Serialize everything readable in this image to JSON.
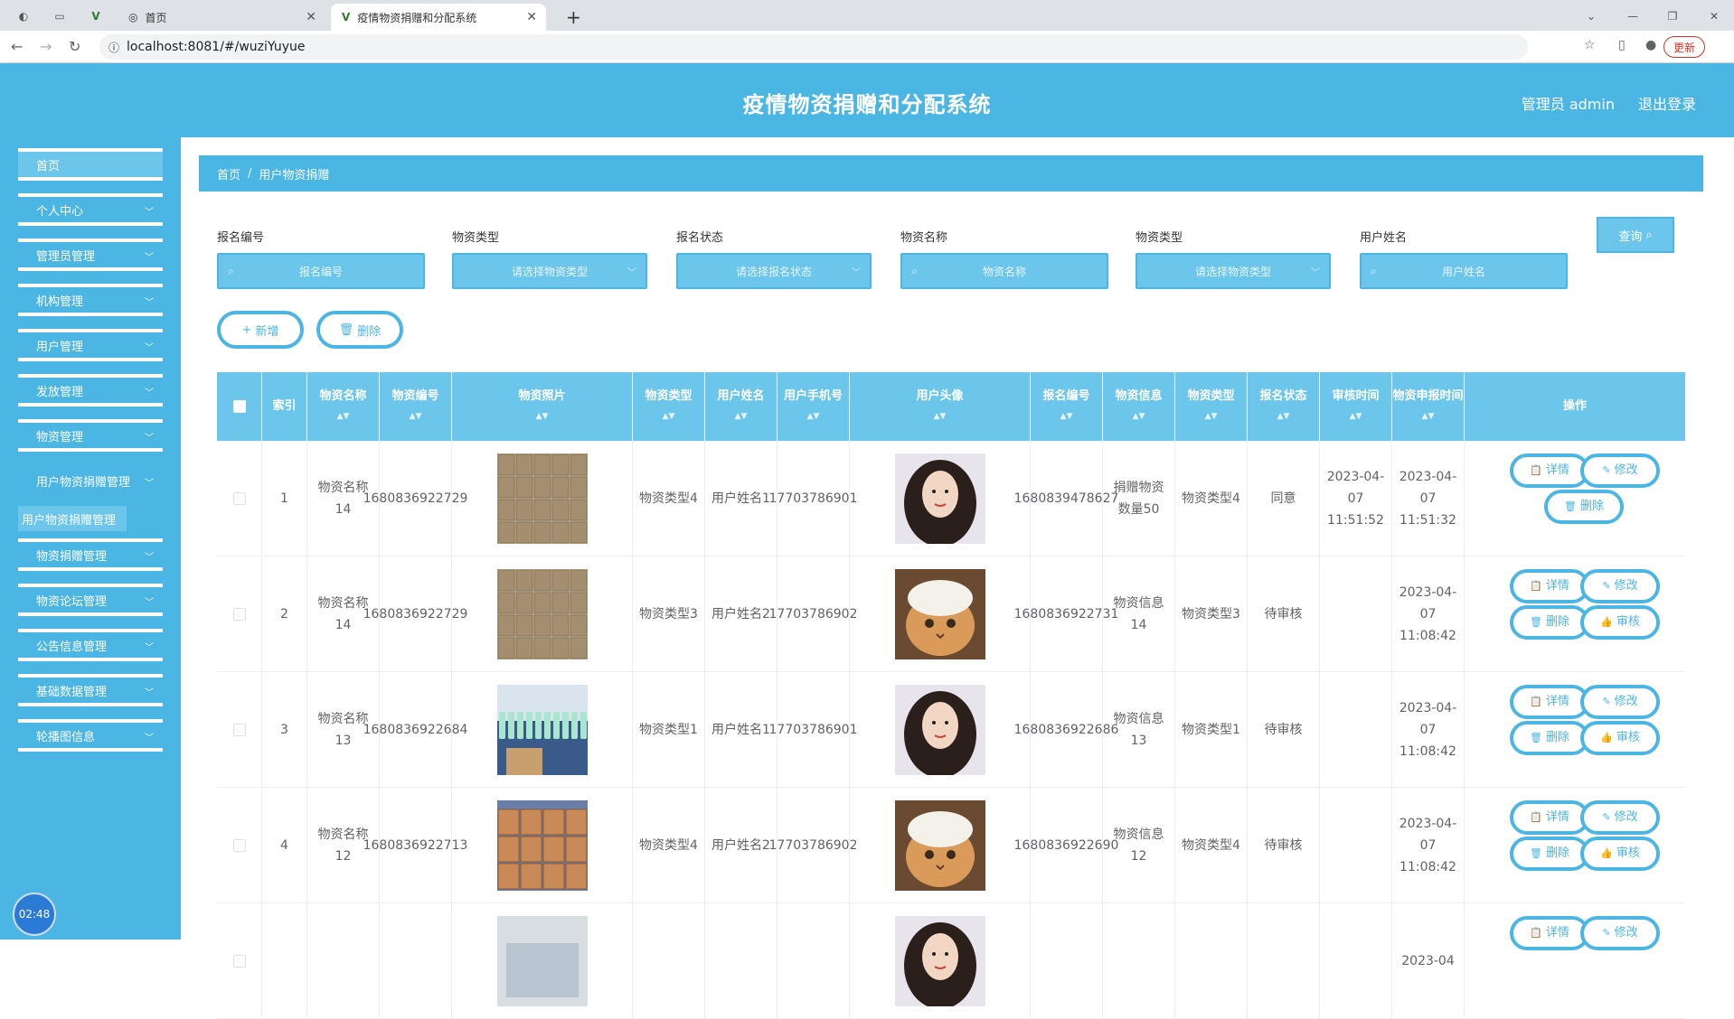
{
  "browser": {
    "tabs": [
      {
        "label": "首页"
      },
      {
        "label": "疫情物资捐赠和分配系统"
      }
    ],
    "url": "localhost:8081/#/wuziYuyue",
    "update_label": "更新"
  },
  "header": {
    "title": "疫情物资捐赠和分配系统",
    "admin_label": "管理员 admin",
    "logout_label": "退出登录"
  },
  "sidebar": {
    "items": [
      {
        "label": "首页"
      },
      {
        "label": "个人中心"
      },
      {
        "label": "管理员管理"
      },
      {
        "label": "机构管理"
      },
      {
        "label": "用户管理"
      },
      {
        "label": "发放管理"
      },
      {
        "label": "物资管理"
      },
      {
        "label": "用户物资捐赠管理"
      },
      {
        "label": "物资捐赠管理"
      },
      {
        "label": "物资论坛管理"
      },
      {
        "label": "公告信息管理"
      },
      {
        "label": "基础数据管理"
      },
      {
        "label": "轮播图信息"
      }
    ],
    "submenu_label": "用户物资捐赠管理",
    "clock": "02:48"
  },
  "breadcrumb": {
    "home": "首页",
    "current": "用户物资捐赠"
  },
  "filters": [
    {
      "label": "报名编号",
      "placeholder": "报名编号",
      "kind": "search"
    },
    {
      "label": "物资类型",
      "placeholder": "请选择物资类型",
      "kind": "select"
    },
    {
      "label": "报名状态",
      "placeholder": "请选择报名状态",
      "kind": "select"
    },
    {
      "label": "物资名称",
      "placeholder": "物资名称",
      "kind": "search"
    },
    {
      "label": "物资类型",
      "placeholder": "请选择物资类型",
      "kind": "select"
    },
    {
      "label": "用户姓名",
      "placeholder": "用户姓名",
      "kind": "search"
    }
  ],
  "query_label": "查询",
  "actions": {
    "add": "新增",
    "delete": "删除"
  },
  "table": {
    "headers": [
      "索引",
      "物资名称",
      "物资编号",
      "物资照片",
      "物资类型",
      "用户姓名",
      "用户手机号",
      "用户头像",
      "报名编号",
      "物资信息",
      "物资类型",
      "报名状态",
      "审核时间",
      "物资申报时间",
      "操作"
    ],
    "rows": [
      {
        "index": "1",
        "name": "物资名称14",
        "code": "1680836922729",
        "type": "物资类型4",
        "user": "用户姓名1",
        "phone": "17703786901",
        "apply_no": "1680839478627",
        "info": "捐赠物资数量50",
        "type2": "物资类型4",
        "status": "同意",
        "audit_time": "2023-04-07 11:51:52",
        "apply_time": "2023-04-07 11:51:32",
        "photo": "boxes",
        "avatar": "woman"
      },
      {
        "index": "2",
        "name": "物资名称14",
        "code": "1680836922729",
        "type": "物资类型3",
        "user": "用户姓名2",
        "phone": "17703786902",
        "apply_no": "1680836922731",
        "info": "物资信息14",
        "type2": "物资类型3",
        "status": "待审核",
        "audit_time": "",
        "apply_time": "2023-04-07 11:08:42",
        "photo": "boxes",
        "avatar": "cat"
      },
      {
        "index": "3",
        "name": "物资名称13",
        "code": "1680836922684",
        "type": "物资类型1",
        "user": "用户姓名1",
        "phone": "17703786901",
        "apply_no": "1680836922686",
        "info": "物资信息13",
        "type2": "物资类型1",
        "status": "待审核",
        "audit_time": "",
        "apply_time": "2023-04-07 11:08:42",
        "photo": "bottles",
        "avatar": "woman"
      },
      {
        "index": "4",
        "name": "物资名称12",
        "code": "1680836922713",
        "type": "物资类型4",
        "user": "用户姓名2",
        "phone": "17703786902",
        "apply_no": "1680836922690",
        "info": "物资信息12",
        "type2": "物资类型4",
        "status": "待审核",
        "audit_time": "",
        "apply_time": "2023-04-07 11:08:42",
        "photo": "cartons",
        "avatar": "cat"
      },
      {
        "index": "",
        "name": "",
        "code": "",
        "type": "",
        "user": "",
        "phone": "",
        "apply_no": "",
        "info": "",
        "type2": "",
        "status": "",
        "audit_time": "",
        "apply_time": "2023-04",
        "photo": "room",
        "avatar": "woman"
      }
    ],
    "op_labels": {
      "detail": "详情",
      "edit": "修改",
      "delete": "删除",
      "audit": "审核"
    }
  }
}
